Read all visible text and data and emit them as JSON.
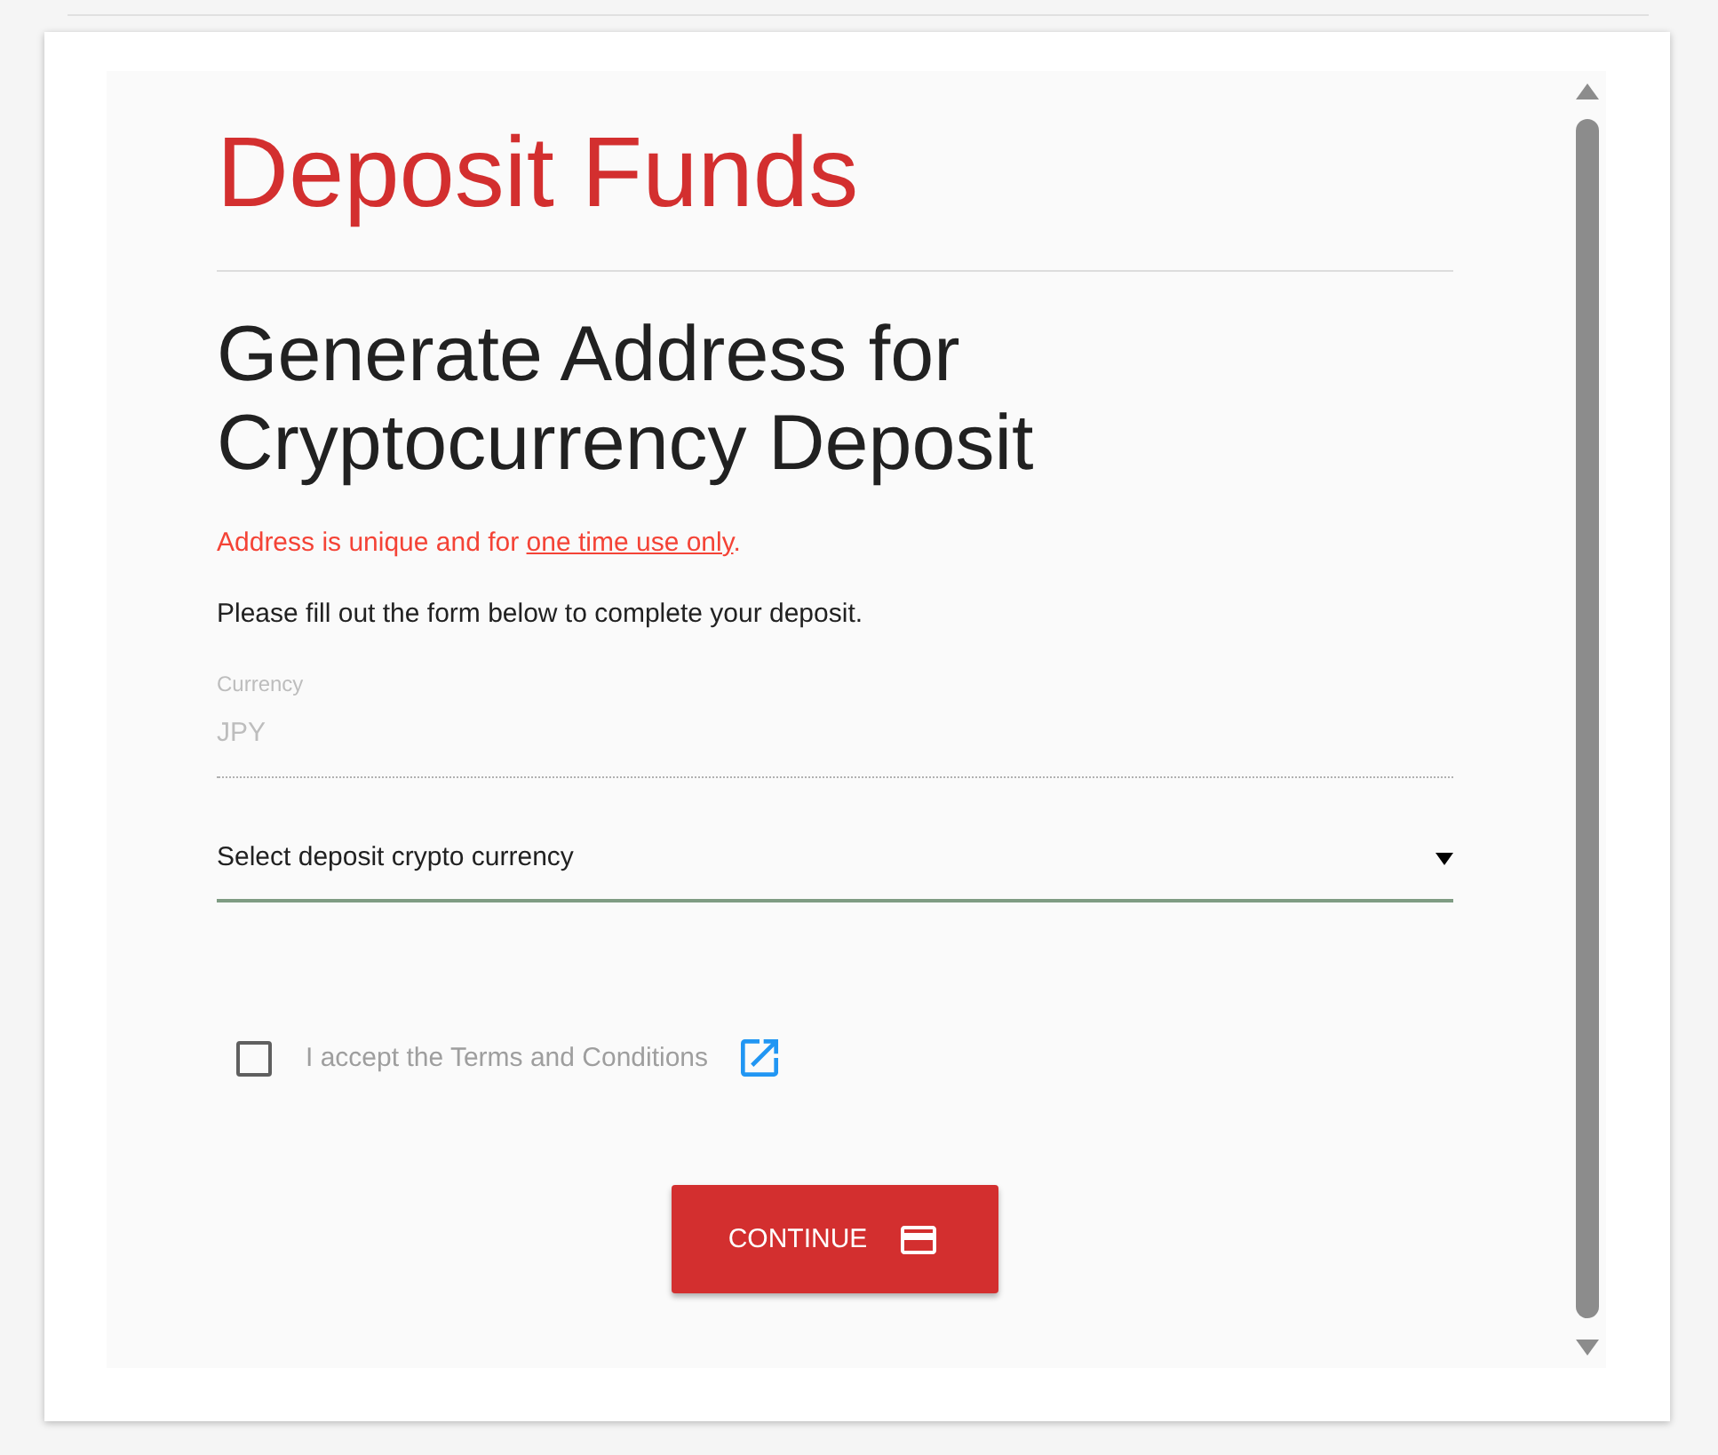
{
  "title": "Deposit Funds",
  "heading": "Generate Address for Cryptocurrency Deposit",
  "notice": {
    "text": "Address is unique and for ",
    "link": "one time use only",
    "end": "."
  },
  "instructions": "Please fill out the form below to complete your deposit.",
  "currency_field": {
    "label": "Currency",
    "value": "JPY",
    "disabled": true
  },
  "crypto_select": {
    "value": "Select deposit crypto currency"
  },
  "terms": {
    "label": "I accept the Terms and Conditions",
    "checked": false
  },
  "continue_button": {
    "label": "CONTINUE"
  }
}
